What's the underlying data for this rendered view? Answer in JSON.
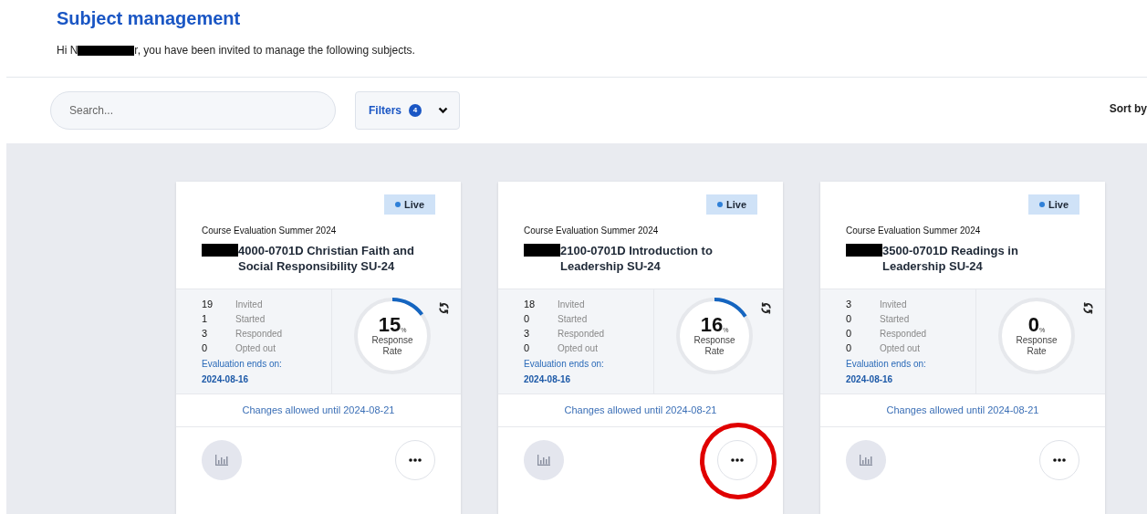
{
  "page_title": "Subject management",
  "greeting": {
    "before": "Hi N",
    "after": "r, you have been invited to manage the following subjects."
  },
  "search": {
    "placeholder": "Search..."
  },
  "filters": {
    "label": "Filters",
    "count": "4"
  },
  "sort": {
    "label": "Sort by"
  },
  "cards": [
    {
      "status": "Live",
      "survey": "Course Evaluation Summer 2024",
      "title": "4000-0701D Christian Faith and Social Responsibility SU-24",
      "stats": [
        {
          "value": "19",
          "label": "Invited"
        },
        {
          "value": "1",
          "label": "Started"
        },
        {
          "value": "3",
          "label": "Responded"
        },
        {
          "value": "0",
          "label": "Opted out"
        }
      ],
      "ends_label": "Evaluation ends on:",
      "ends_date": "2024-08-16",
      "rate": "15",
      "rate_unit": "%",
      "rate_label": "Response Rate",
      "changes": "Changes allowed until 2024-08-21",
      "highlighted": false
    },
    {
      "status": "Live",
      "survey": "Course Evaluation Summer 2024",
      "title": "2100-0701D Introduction to Leadership SU-24",
      "stats": [
        {
          "value": "18",
          "label": "Invited"
        },
        {
          "value": "0",
          "label": "Started"
        },
        {
          "value": "3",
          "label": "Responded"
        },
        {
          "value": "0",
          "label": "Opted out"
        }
      ],
      "ends_label": "Evaluation ends on:",
      "ends_date": "2024-08-16",
      "rate": "16",
      "rate_unit": "%",
      "rate_label": "Response Rate",
      "changes": "Changes allowed until 2024-08-21",
      "highlighted": true
    },
    {
      "status": "Live",
      "survey": "Course Evaluation Summer 2024",
      "title": "3500-0701D Readings in Leadership SU-24",
      "stats": [
        {
          "value": "3",
          "label": "Invited"
        },
        {
          "value": "0",
          "label": "Started"
        },
        {
          "value": "0",
          "label": "Responded"
        },
        {
          "value": "0",
          "label": "Opted out"
        }
      ],
      "ends_label": "Evaluation ends on:",
      "ends_date": "2024-08-16",
      "rate": "0",
      "rate_unit": "%",
      "rate_label": "Response Rate",
      "changes": "Changes allowed until 2024-08-21",
      "highlighted": false
    }
  ]
}
